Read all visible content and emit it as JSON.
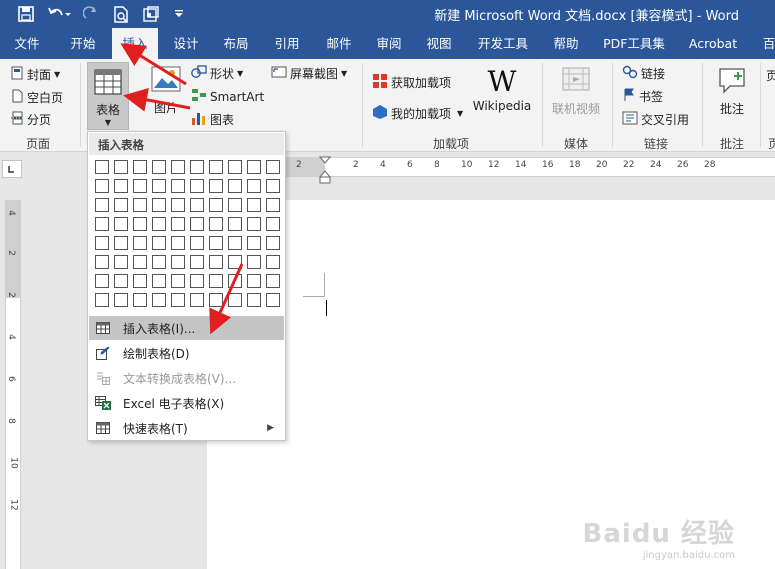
{
  "window": {
    "title": "新建 Microsoft Word 文档.docx [兼容模式] - Word"
  },
  "quick_access": {
    "save_icon": "save-icon",
    "undo_icon": "undo-icon",
    "redo_icon": "redo-icon",
    "print_preview_icon": "print-preview-icon",
    "touch_mode_icon": "touch-mode-icon",
    "customize_icon": "customize-qat-icon"
  },
  "tabs": [
    "文件",
    "开始",
    "插入",
    "设计",
    "布局",
    "引用",
    "邮件",
    "审阅",
    "视图",
    "开发工具",
    "帮助",
    "PDF工具集",
    "Acrobat",
    "百"
  ],
  "active_tab": "插入",
  "ribbon": {
    "pages": {
      "cover": "封面",
      "blank": "空白页",
      "break": "分页",
      "label": "页面"
    },
    "tables": {
      "table": "表格"
    },
    "illustrations": {
      "picture": "图片",
      "shapes": "形状",
      "smartart": "SmartArt",
      "chart": "图表",
      "screenshot": "屏幕截图"
    },
    "addins": {
      "get": "获取加载项",
      "my": "我的加载项",
      "wikipedia": "Wikipedia",
      "label": "加载项"
    },
    "media": {
      "online_video": "联机视频",
      "label": "媒体"
    },
    "links": {
      "link": "链接",
      "bookmark": "书签",
      "cross_ref": "交叉引用",
      "label": "链接"
    },
    "comments": {
      "comment": "批注",
      "label": "批注"
    },
    "cut_label": "页"
  },
  "ruler": {
    "h_numbers": [
      "2",
      "2",
      "4",
      "6",
      "8",
      "10",
      "12",
      "14",
      "16",
      "18",
      "20",
      "22",
      "24",
      "26",
      "28"
    ],
    "v_numbers": [
      "4",
      "2",
      "2",
      "4",
      "6",
      "8",
      "10",
      "12"
    ]
  },
  "dropdown": {
    "header": "插入表格",
    "grid": {
      "cols": 10,
      "rows": 8
    },
    "items": [
      {
        "label": "插入表格(I)...",
        "icon": "insert-table-icon",
        "state": "hover"
      },
      {
        "label": "绘制表格(D)",
        "icon": "draw-table-icon",
        "state": "normal"
      },
      {
        "label": "文本转换成表格(V)...",
        "icon": "text-to-table-icon",
        "state": "disabled"
      },
      {
        "label": "Excel 电子表格(X)",
        "icon": "excel-icon",
        "state": "normal"
      },
      {
        "label": "快速表格(T)",
        "icon": "quick-table-icon",
        "state": "submenu"
      }
    ]
  },
  "watermark": {
    "main": "Baidu 经验",
    "sub": "jingyan.baidu.com"
  },
  "colors": {
    "brand": "#2b579a",
    "ribbon_bg": "#f3f3f3",
    "arrow": "#e02020"
  }
}
